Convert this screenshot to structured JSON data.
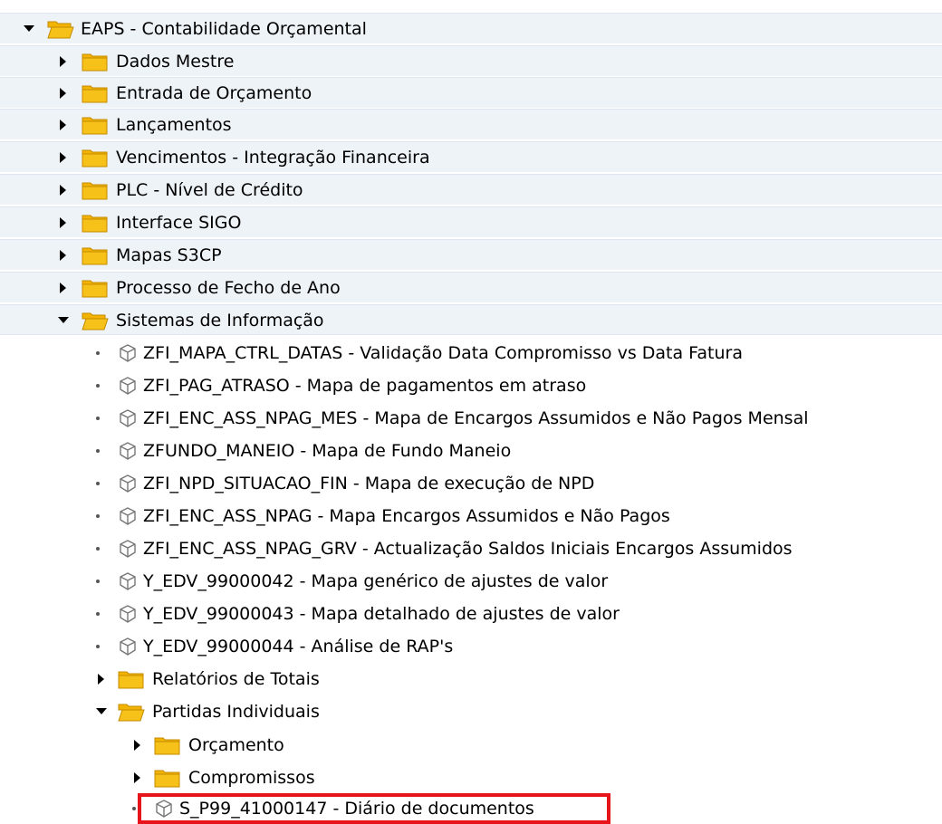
{
  "tree": {
    "root": {
      "label": "EAPS - Contabilidade Orçamental",
      "expanded": true,
      "icon": "folder-open-icon"
    },
    "level1": [
      {
        "label": "Dados Mestre",
        "expanded": false,
        "icon": "folder-icon"
      },
      {
        "label": "Entrada de Orçamento",
        "expanded": false,
        "icon": "folder-icon"
      },
      {
        "label": "Lançamentos",
        "expanded": false,
        "icon": "folder-icon"
      },
      {
        "label": "Vencimentos - Integração Financeira",
        "expanded": false,
        "icon": "folder-icon"
      },
      {
        "label": "PLC - Nível de Crédito",
        "expanded": false,
        "icon": "folder-icon"
      },
      {
        "label": "Interface SIGO",
        "expanded": false,
        "icon": "folder-icon"
      },
      {
        "label": "Mapas S3CP",
        "expanded": false,
        "icon": "folder-icon"
      },
      {
        "label": "Processo de Fecho de Ano",
        "expanded": false,
        "icon": "folder-icon"
      },
      {
        "label": "Sistemas de Informação",
        "expanded": true,
        "icon": "folder-open-icon"
      }
    ],
    "level2_transactions": [
      {
        "label": "ZFI_MAPA_CTRL_DATAS - Validação Data Compromisso vs Data Fatura",
        "icon": "transaction-cube-icon"
      },
      {
        "label": "ZFI_PAG_ATRASO - Mapa de pagamentos em atraso",
        "icon": "transaction-cube-icon"
      },
      {
        "label": "ZFI_ENC_ASS_NPAG_MES - Mapa de Encargos Assumidos e Não Pagos Mensal",
        "icon": "transaction-cube-icon"
      },
      {
        "label": "ZFUNDO_MANEIO - Mapa de Fundo Maneio",
        "icon": "transaction-cube-icon"
      },
      {
        "label": "ZFI_NPD_SITUACAO_FIN - Mapa de execução de NPD",
        "icon": "transaction-cube-icon"
      },
      {
        "label": "ZFI_ENC_ASS_NPAG - Mapa Encargos Assumidos e Não Pagos",
        "icon": "transaction-cube-icon"
      },
      {
        "label": "ZFI_ENC_ASS_NPAG_GRV - Actualização Saldos Iniciais Encargos Assumidos",
        "icon": "transaction-cube-icon"
      },
      {
        "label": "Y_EDV_99000042 - Mapa genérico de ajustes de valor",
        "icon": "transaction-cube-icon"
      },
      {
        "label": "Y_EDV_99000043 - Mapa detalhado de ajustes de valor",
        "icon": "transaction-cube-icon"
      },
      {
        "label": "Y_EDV_99000044 - Análise de RAP's",
        "icon": "transaction-cube-icon"
      }
    ],
    "level2_folders": [
      {
        "label": "Relatórios de Totais",
        "expanded": false,
        "icon": "folder-icon"
      },
      {
        "label": "Partidas Individuais",
        "expanded": true,
        "icon": "folder-open-icon"
      }
    ],
    "level3_folders": [
      {
        "label": "Orçamento",
        "expanded": false,
        "icon": "folder-icon"
      },
      {
        "label": "Compromissos",
        "expanded": false,
        "icon": "folder-icon"
      }
    ],
    "level3_transactions": [
      {
        "label": "S_P99_41000147 - Diário de documentos",
        "icon": "transaction-cube-icon",
        "highlighted": true
      }
    ]
  },
  "colors": {
    "folder_fill": "#f2b400",
    "folder_outline": "#c48a00",
    "shaded_row": "#eef3f8",
    "highlight_border": "#e8141c"
  }
}
